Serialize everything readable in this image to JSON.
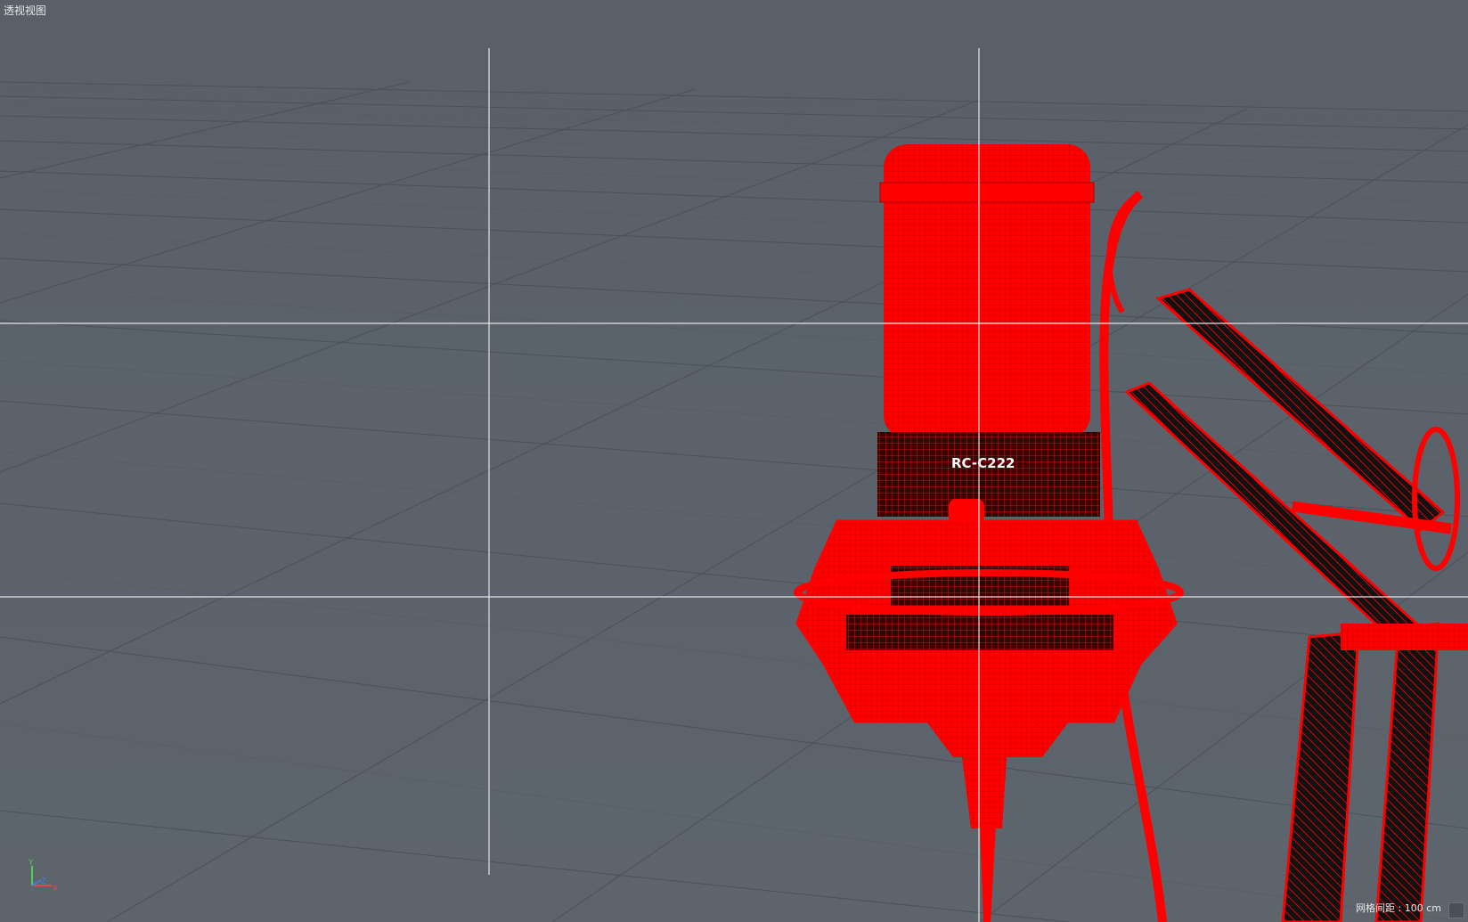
{
  "viewport": {
    "title": "透视视图",
    "status": {
      "grid_spacing": "网格间距 : 100 cm"
    },
    "model_label": "RC-C222",
    "axis": {
      "y": "Y",
      "z": "Z",
      "x": "X"
    },
    "colors": {
      "background": "#5d646c",
      "grid": "#4e545b",
      "crosshair": "#e6e6e6",
      "model": "#ff0000",
      "model_dark": "#8a0000",
      "arm": "#111111"
    }
  }
}
